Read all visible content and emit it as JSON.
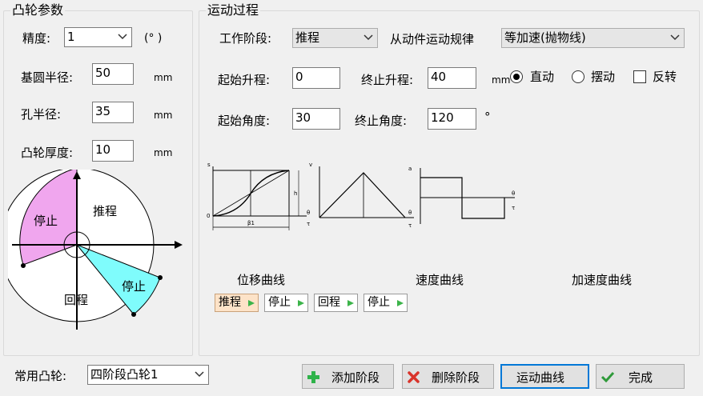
{
  "cam_params": {
    "legend": "凸轮参数",
    "precision_label": "精度:",
    "precision_value": "1",
    "precision_unit": "(° )",
    "base_radius_label": "基圆半径:",
    "base_radius_value": "50",
    "hole_radius_label": "孔半径:",
    "hole_radius_value": "35",
    "thickness_label": "凸轮厚度:",
    "thickness_value": "10",
    "unit_mm": "mm",
    "diagram": {
      "push": "推程",
      "dwell_top": "停止",
      "dwell_bottom": "停止",
      "return": "回程",
      "colors": {
        "dwell_top": "#f0a6ee",
        "dwell_bottom": "#7ffcfc"
      }
    }
  },
  "motion": {
    "legend": "运动过程",
    "stage_label": "工作阶段:",
    "stage_value": "推程",
    "law_label": "从动件运动规律",
    "law_value": "等加速(抛物线)",
    "start_lift_label": "起始升程:",
    "start_lift_value": "0",
    "end_lift_label": "终止升程:",
    "end_lift_value": "40",
    "lift_unit": "mm",
    "radio_translate": "直动",
    "radio_swing": "摆动",
    "check_reverse": "反转",
    "start_angle_label": "起始角度:",
    "start_angle_value": "30",
    "end_angle_label": "终止角度:",
    "end_angle_value": "120",
    "angle_unit": "°",
    "curve_labels": {
      "displacement": "位移曲线",
      "velocity": "速度曲线",
      "acceleration": "加速度曲线"
    },
    "graph_marks": {
      "s": "s",
      "v": "v",
      "a": "a",
      "h": "h",
      "theta": "θ",
      "tau": "τ",
      "zero": "0",
      "beta1": "β1"
    },
    "steps": [
      "推程",
      "停止",
      "回程",
      "停止"
    ],
    "active_step": 0
  },
  "bottom": {
    "common_cam_label": "常用凸轮:",
    "common_cam_value": "四阶段凸轮1",
    "add_stage": "添加阶段",
    "delete_stage": "删除阶段",
    "motion_curve": "运动曲线",
    "finish": "完成"
  },
  "colors": {
    "active_step_bg": "#fde3c8",
    "default_button_border": "#0078d7",
    "add_icon": "#2fb34a",
    "delete_icon": "#d9342b",
    "finish_icon": "#2f9a3a"
  }
}
